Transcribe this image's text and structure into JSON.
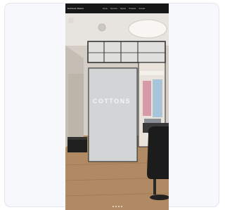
{
  "header": {
    "brand": "Cottons Salon",
    "nav": [
      "Home",
      "Services",
      "Stylists",
      "Products",
      "Contact"
    ]
  },
  "scene": {
    "door_sign": "COTTONS"
  },
  "pager": {
    "pages": 4
  },
  "colors": {
    "header_bg": "#161616",
    "floor": "#b08a63",
    "glass_door": "#c9cccd",
    "frame_dark": "#2a2a2a"
  }
}
